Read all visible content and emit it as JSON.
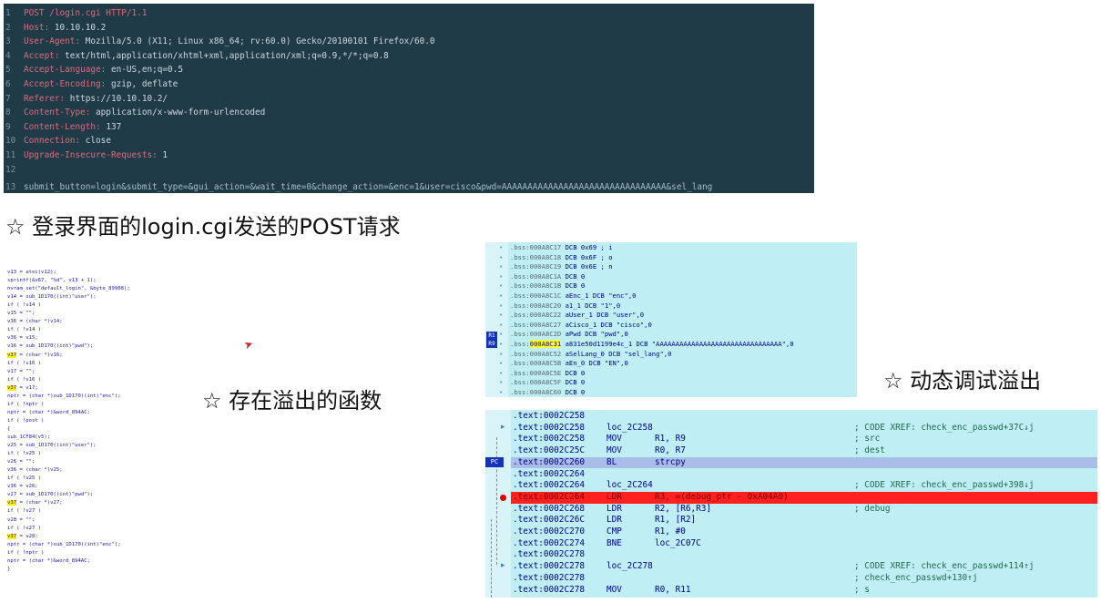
{
  "http_request": {
    "lines": [
      {
        "num": "1",
        "key": "POST /login.cgi HTTP/1.1",
        "value": ""
      },
      {
        "num": "2",
        "key": "Host:",
        "value": " 10.10.10.2"
      },
      {
        "num": "3",
        "key": "User-Agent:",
        "value": " Mozilla/5.0 (X11; Linux x86_64; rv:60.0) Gecko/20100101 Firefox/60.0"
      },
      {
        "num": "4",
        "key": "Accept:",
        "value": " text/html,application/xhtml+xml,application/xml;q=0.9,*/*;q=0.8"
      },
      {
        "num": "5",
        "key": "Accept-Language:",
        "value": " en-US,en;q=0.5"
      },
      {
        "num": "6",
        "key": "Accept-Encoding:",
        "value": " gzip, deflate"
      },
      {
        "num": "7",
        "key": "Referer:",
        "value": " https://10.10.10.2/"
      },
      {
        "num": "8",
        "key": "Content-Type:",
        "value": " application/x-www-form-urlencoded"
      },
      {
        "num": "9",
        "key": "Content-Length:",
        "value": " 137"
      },
      {
        "num": "10",
        "key": "Connection:",
        "value": " close"
      },
      {
        "num": "11",
        "key": "Upgrade-Insecure-Requests:",
        "value": " 1"
      },
      {
        "num": "12",
        "key": "",
        "value": ""
      }
    ],
    "body_line": {
      "num": "13",
      "text": "submit_button=login&submit_type=&gui_action=&wait_time=0&change_action=&enc=1&user=cisco&pwd=AAAAAAAAAAAAAAAAAAAAAAAAAAAAAAAA&sel_lang"
    }
  },
  "captions": {
    "post": "☆ 登录界面的login.cgi发送的POST请求",
    "func": "☆ 存在溢出的函数",
    "debug": "☆ 动态调试溢出"
  },
  "decompiled": [
    {
      "pre": "v13 = atoi(v12);",
      "hl": "",
      "post": ""
    },
    {
      "pre": "sprintf(&v67, \"%d\", v13 + 1);",
      "hl": "",
      "post": ""
    },
    {
      "pre": "nvram_set(\"default_login\", &byte_89908);",
      "hl": "",
      "post": ""
    },
    {
      "pre": "v14 = sub_1D170((int)\"user\");",
      "hl": "",
      "post": ""
    },
    {
      "pre": "if ( !v14 )",
      "hl": "",
      "post": ""
    },
    {
      "pre": "  v15 = \"\";",
      "hl": "",
      "post": ""
    },
    {
      "pre": "v36 = (char *)v14;",
      "hl": "",
      "post": ""
    },
    {
      "pre": "if ( !v14 )",
      "hl": "",
      "post": ""
    },
    {
      "pre": "  v36 = v15;",
      "hl": "",
      "post": ""
    },
    {
      "pre": "v16 = sub_1D170((int)\"pwd\");",
      "hl": "",
      "post": ""
    },
    {
      "pre": "",
      "hl": "v37",
      "post": " = (char *)v16;"
    },
    {
      "pre": "if ( !v16 )",
      "hl": "",
      "post": ""
    },
    {
      "pre": "  v17 = \"\";",
      "hl": "",
      "post": ""
    },
    {
      "pre": "if ( !v16 )",
      "hl": "",
      "post": ""
    },
    {
      "pre": "  ",
      "hl": "v37",
      "post": " = v17;"
    },
    {
      "pre": "nptr = (char *)sub_1D170((int)\"enc\");",
      "hl": "",
      "post": ""
    },
    {
      "pre": "if ( !nptr )",
      "hl": "",
      "post": ""
    },
    {
      "pre": "  nptr = (char *)&word_894AC;",
      "hl": "",
      "post": ""
    },
    {
      "pre": "if ( !post )",
      "hl": "",
      "post": ""
    },
    {
      "pre": "{",
      "hl": "",
      "post": ""
    },
    {
      "pre": "  sub_1CF84(v5);",
      "hl": "",
      "post": ""
    },
    {
      "pre": "  v25 = sub_1D170((int)\"user\");",
      "hl": "",
      "post": ""
    },
    {
      "pre": "  if ( !v25 )",
      "hl": "",
      "post": ""
    },
    {
      "pre": "    v26 = \"\";",
      "hl": "",
      "post": ""
    },
    {
      "pre": "  v36 = (char *)v25;",
      "hl": "",
      "post": ""
    },
    {
      "pre": "  if ( !v25 )",
      "hl": "",
      "post": ""
    },
    {
      "pre": "    v36 = v26;",
      "hl": "",
      "post": ""
    },
    {
      "pre": "  v27 = sub_1D170((int)\"pwd\");",
      "hl": "",
      "post": ""
    },
    {
      "pre": "  ",
      "hl": "v37",
      "post": " = (char *)v27;"
    },
    {
      "pre": "  if ( !v27 )",
      "hl": "",
      "post": ""
    },
    {
      "pre": "    v28 = \"\";",
      "hl": "",
      "post": ""
    },
    {
      "pre": "  if ( !v27 )",
      "hl": "",
      "post": ""
    },
    {
      "pre": "    ",
      "hl": "v37",
      "post": " = v28;"
    },
    {
      "pre": "  nptr = (char *)sub_1D170((int)\"enc\");",
      "hl": "",
      "post": ""
    },
    {
      "pre": "  if ( !nptr )",
      "hl": "",
      "post": ""
    },
    {
      "pre": "    nptr = (char *)&word_894AC;",
      "hl": "",
      "post": ""
    },
    {
      "pre": "}",
      "hl": "",
      "post": ""
    }
  ],
  "bss_lines": [
    {
      "addr": ".bss:000A8C17",
      "hl": "",
      "rest": " DCB 0x69 ; i"
    },
    {
      "addr": ".bss:000A8C18",
      "hl": "",
      "rest": " DCB 0x6F ; o"
    },
    {
      "addr": ".bss:000A8C19",
      "hl": "",
      "rest": " DCB 0x6E ; n"
    },
    {
      "addr": ".bss:000A8C1A",
      "hl": "",
      "rest": " DCB    0"
    },
    {
      "addr": ".bss:000A8C1B",
      "hl": "",
      "rest": " DCB    0"
    },
    {
      "addr": ".bss:000A8C1C",
      "hl": "",
      "rest": " aEnc_1 DCB \"enc\",0"
    },
    {
      "addr": ".bss:000A8C20",
      "hl": "",
      "rest": " a1_1 DCB \"1\",0"
    },
    {
      "addr": ".bss:000A8C22",
      "hl": "",
      "rest": " aUser_1 DCB \"user\",0"
    },
    {
      "addr": ".bss:000A8C27",
      "hl": "",
      "rest": " aCisco_1 DCB \"cisco\",0"
    },
    {
      "addr": ".bss:000A8C2D",
      "hl": "",
      "rest": " aPwd DCB \"pwd\",0"
    },
    {
      "addr": ".bss:",
      "hl": "000A8C31",
      "rest": " a831e50d1199e4c_1 DCB \"AAAAAAAAAAAAAAAAAAAAAAAAAAAAAAAA\",0"
    },
    {
      "addr": ".bss:000A8C52",
      "hl": "",
      "rest": " aSelLang_0 DCB \"sel_lang\",0"
    },
    {
      "addr": ".bss:000A8C5B",
      "hl": "",
      "rest": " aEn_0 DCB \"EN\",0"
    },
    {
      "addr": ".bss:000A8C5E",
      "hl": "",
      "rest": " DCB    0"
    },
    {
      "addr": ".bss:000A8C5F",
      "hl": "",
      "rest": " DCB    0"
    },
    {
      "addr": ".bss:000A8C60",
      "hl": "",
      "rest": " DCB    0"
    }
  ],
  "bss_markers": [
    "R1",
    "R9"
  ],
  "text_lines": [
    {
      "addr": ".text:0002C258",
      "op": "",
      "args": "",
      "cmt": "",
      "style": ""
    },
    {
      "addr": ".text:0002C258",
      "op": "loc_2C258",
      "args": "",
      "cmt": "; CODE XREF: check_enc_passwd+37C↓j",
      "style": ""
    },
    {
      "addr": ".text:0002C258",
      "op": "MOV",
      "args": "R1, R9",
      "cmt": "; src",
      "style": ""
    },
    {
      "addr": ".text:0002C25C",
      "op": "MOV",
      "args": "R0, R7",
      "cmt": "; dest",
      "style": ""
    },
    {
      "addr": ".text:0002C260",
      "op": "BL",
      "args": "strcpy",
      "cmt": "",
      "style": "sel"
    },
    {
      "addr": ".text:0002C264",
      "op": "",
      "args": "",
      "cmt": "",
      "style": ""
    },
    {
      "addr": ".text:0002C264",
      "op": "loc_2C264",
      "args": "",
      "cmt": "; CODE XREF: check_enc_passwd+398↓j",
      "style": ""
    },
    {
      "addr": ".text:0002C264",
      "op": "LDR",
      "args": "R3, =(debug_ptr - 0xA04A0)",
      "cmt": "",
      "style": "bp"
    },
    {
      "addr": ".text:0002C268",
      "op": "LDR",
      "args": "R2, [R6,R3]",
      "cmt": "; debug",
      "style": ""
    },
    {
      "addr": ".text:0002C26C",
      "op": "LDR",
      "args": "R1, [R2]",
      "cmt": "",
      "style": ""
    },
    {
      "addr": ".text:0002C270",
      "op": "CMP",
      "args": "R1, #0",
      "cmt": "",
      "style": ""
    },
    {
      "addr": ".text:0002C274",
      "op": "BNE",
      "args": "loc_2C07C",
      "cmt": "",
      "style": ""
    },
    {
      "addr": ".text:0002C278",
      "op": "",
      "args": "",
      "cmt": "",
      "style": ""
    },
    {
      "addr": ".text:0002C278",
      "op": "loc_2C278",
      "args": "",
      "cmt": "; CODE XREF: check_enc_passwd+114↑j",
      "style": ""
    },
    {
      "addr": ".text:0002C278",
      "op": "",
      "args": "",
      "cmt": "; check_enc_passwd+130↑j",
      "style": ""
    },
    {
      "addr": ".text:0002C278",
      "op": "MOV",
      "args": "R0, R11",
      "cmt": "; s",
      "style": ""
    }
  ],
  "pc_marker": "PC"
}
